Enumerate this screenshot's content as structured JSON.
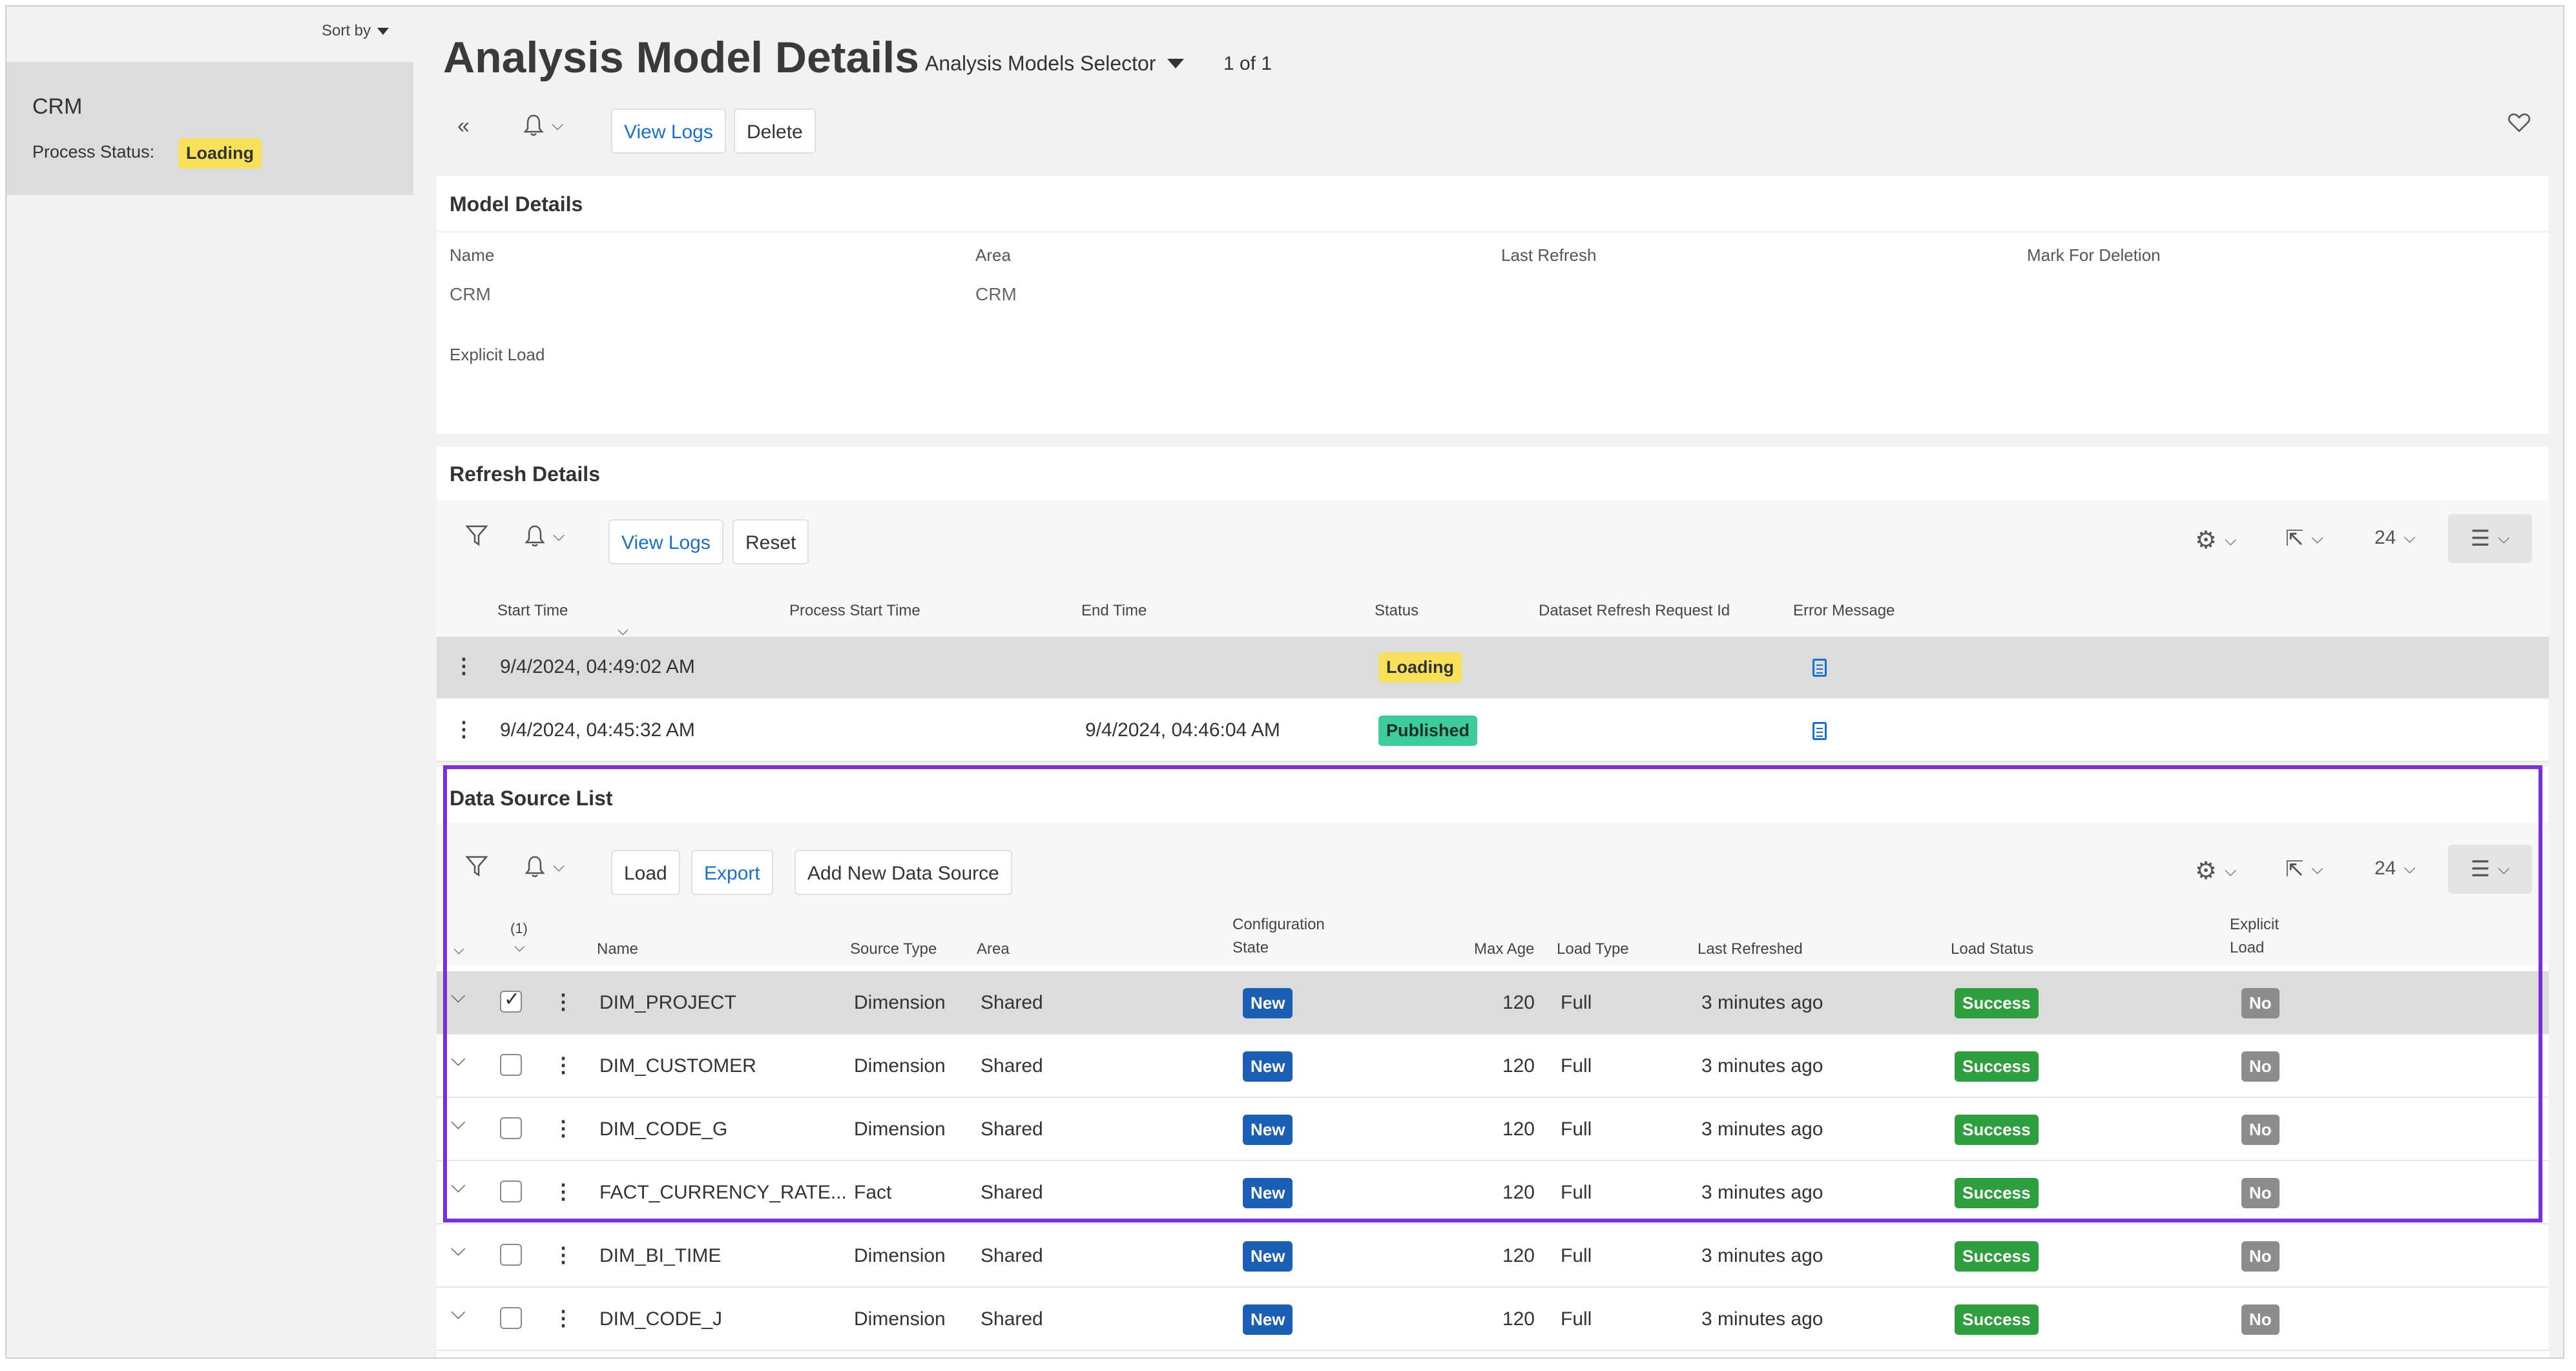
{
  "sidebar": {
    "sort_label": "Sort by",
    "item": {
      "title": "CRM",
      "status_label": "Process Status:",
      "status_value": "Loading"
    }
  },
  "header": {
    "title": "Analysis Model Details",
    "selector_label": "Analysis Models Selector",
    "record_count": "1 of 1"
  },
  "toolbar": {
    "view_logs": "View Logs",
    "delete": "Delete"
  },
  "model_details": {
    "title": "Model Details",
    "fields": [
      {
        "label": "Name",
        "value": "CRM"
      },
      {
        "label": "Area",
        "value": "CRM"
      },
      {
        "label": "Last Refresh",
        "value": ""
      },
      {
        "label": "Mark For Deletion",
        "value": ""
      },
      {
        "label": "Explicit Load",
        "value": ""
      }
    ]
  },
  "refresh_details": {
    "title": "Refresh Details",
    "view_logs": "View Logs",
    "reset": "Reset",
    "page_size": "24",
    "columns": [
      "Start Time",
      "Process Start Time",
      "End Time",
      "Status",
      "Dataset Refresh Request Id",
      "Error Message"
    ],
    "rows": [
      {
        "start": "9/4/2024, 04:49:02 AM",
        "process_start": "",
        "end": "",
        "status": "Loading"
      },
      {
        "start": "9/4/2024, 04:45:32 AM",
        "process_start": "",
        "end": "9/4/2024, 04:46:04 AM",
        "status": "Published"
      }
    ]
  },
  "data_source_list": {
    "title": "Data Source List",
    "load": "Load",
    "export": "Export",
    "add_new": "Add New Data Source",
    "page_size": "24",
    "selected_count": "(1)",
    "columns": {
      "name": "Name",
      "source_type": "Source Type",
      "area": "Area",
      "config_state_1": "Configuration",
      "config_state_2": "State",
      "max_age": "Max Age",
      "load_type": "Load Type",
      "last_refreshed": "Last Refreshed",
      "load_status": "Load Status",
      "explicit_load_1": "Explicit",
      "explicit_load_2": "Load"
    },
    "rows": [
      {
        "name": "DIM_PROJECT",
        "source_type": "Dimension",
        "area": "Shared",
        "config_state": "New",
        "max_age": "120",
        "load_type": "Full",
        "last_refreshed": "3 minutes ago",
        "load_status": "Success",
        "explicit_load": "No"
      },
      {
        "name": "DIM_CUSTOMER",
        "source_type": "Dimension",
        "area": "Shared",
        "config_state": "New",
        "max_age": "120",
        "load_type": "Full",
        "last_refreshed": "3 minutes ago",
        "load_status": "Success",
        "explicit_load": "No"
      },
      {
        "name": "DIM_CODE_G",
        "source_type": "Dimension",
        "area": "Shared",
        "config_state": "New",
        "max_age": "120",
        "load_type": "Full",
        "last_refreshed": "3 minutes ago",
        "load_status": "Success",
        "explicit_load": "No"
      },
      {
        "name": "FACT_CURRENCY_RATE...",
        "source_type": "Fact",
        "area": "Shared",
        "config_state": "New",
        "max_age": "120",
        "load_type": "Full",
        "last_refreshed": "3 minutes ago",
        "load_status": "Success",
        "explicit_load": "No"
      },
      {
        "name": "DIM_BI_TIME",
        "source_type": "Dimension",
        "area": "Shared",
        "config_state": "New",
        "max_age": "120",
        "load_type": "Full",
        "last_refreshed": "3 minutes ago",
        "load_status": "Success",
        "explicit_load": "No"
      },
      {
        "name": "DIM_CODE_J",
        "source_type": "Dimension",
        "area": "Shared",
        "config_state": "New",
        "max_age": "120",
        "load_type": "Full",
        "last_refreshed": "3 minutes ago",
        "load_status": "Success",
        "explicit_load": "No"
      }
    ]
  },
  "colors": {
    "highlight": "#7b2fd6",
    "link": "#1a6fc9"
  },
  "icons": [
    "double-chevron-left-icon",
    "bell-icon",
    "heart-icon",
    "filter-icon",
    "gear-icon",
    "export-icon",
    "list-icon",
    "kebab-icon",
    "document-icon"
  ]
}
